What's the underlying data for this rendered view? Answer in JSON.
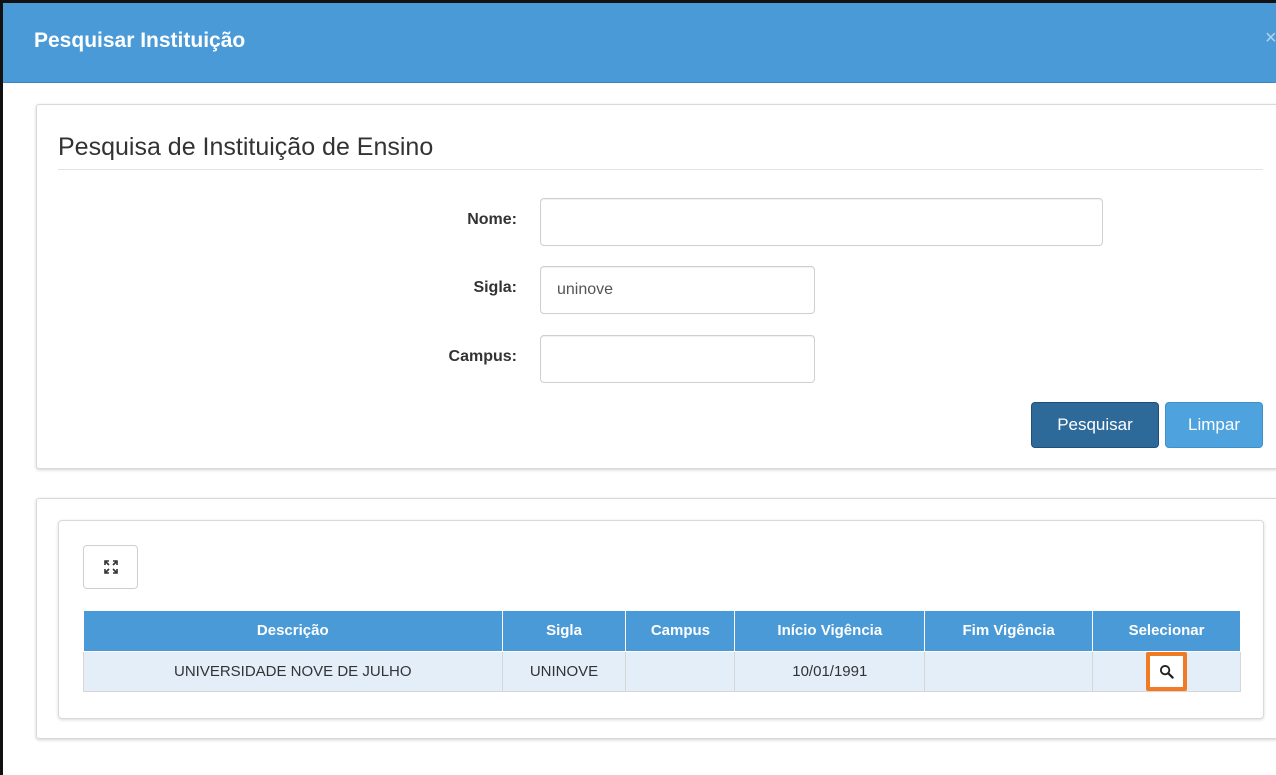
{
  "modal": {
    "title": "Pesquisar Instituição",
    "close_label": "×"
  },
  "search": {
    "title": "Pesquisa de Instituição de Ensino",
    "fields": {
      "nome": {
        "label": "Nome:",
        "value": ""
      },
      "sigla": {
        "label": "Sigla:",
        "value": "uninove"
      },
      "campus": {
        "label": "Campus:",
        "value": ""
      }
    },
    "buttons": {
      "search": "Pesquisar",
      "clear": "Limpar"
    }
  },
  "results": {
    "expand_icon": "expand-icon",
    "columns": [
      "Descrição",
      "Sigla",
      "Campus",
      "Início Vigência",
      "Fim Vigência",
      "Selecionar"
    ],
    "rows": [
      {
        "descricao": "UNIVERSIDADE NOVE DE JULHO",
        "sigla": "UNINOVE",
        "campus": "",
        "inicio_vigencia": "10/01/1991",
        "fim_vigencia": "",
        "select_icon": "search-icon"
      }
    ]
  },
  "colors": {
    "header": "#4a9ad8",
    "primary_button": "#2d6a9a",
    "info_button": "#4ea3df",
    "row_background": "#e3eef9",
    "highlight": "#f07b22"
  }
}
